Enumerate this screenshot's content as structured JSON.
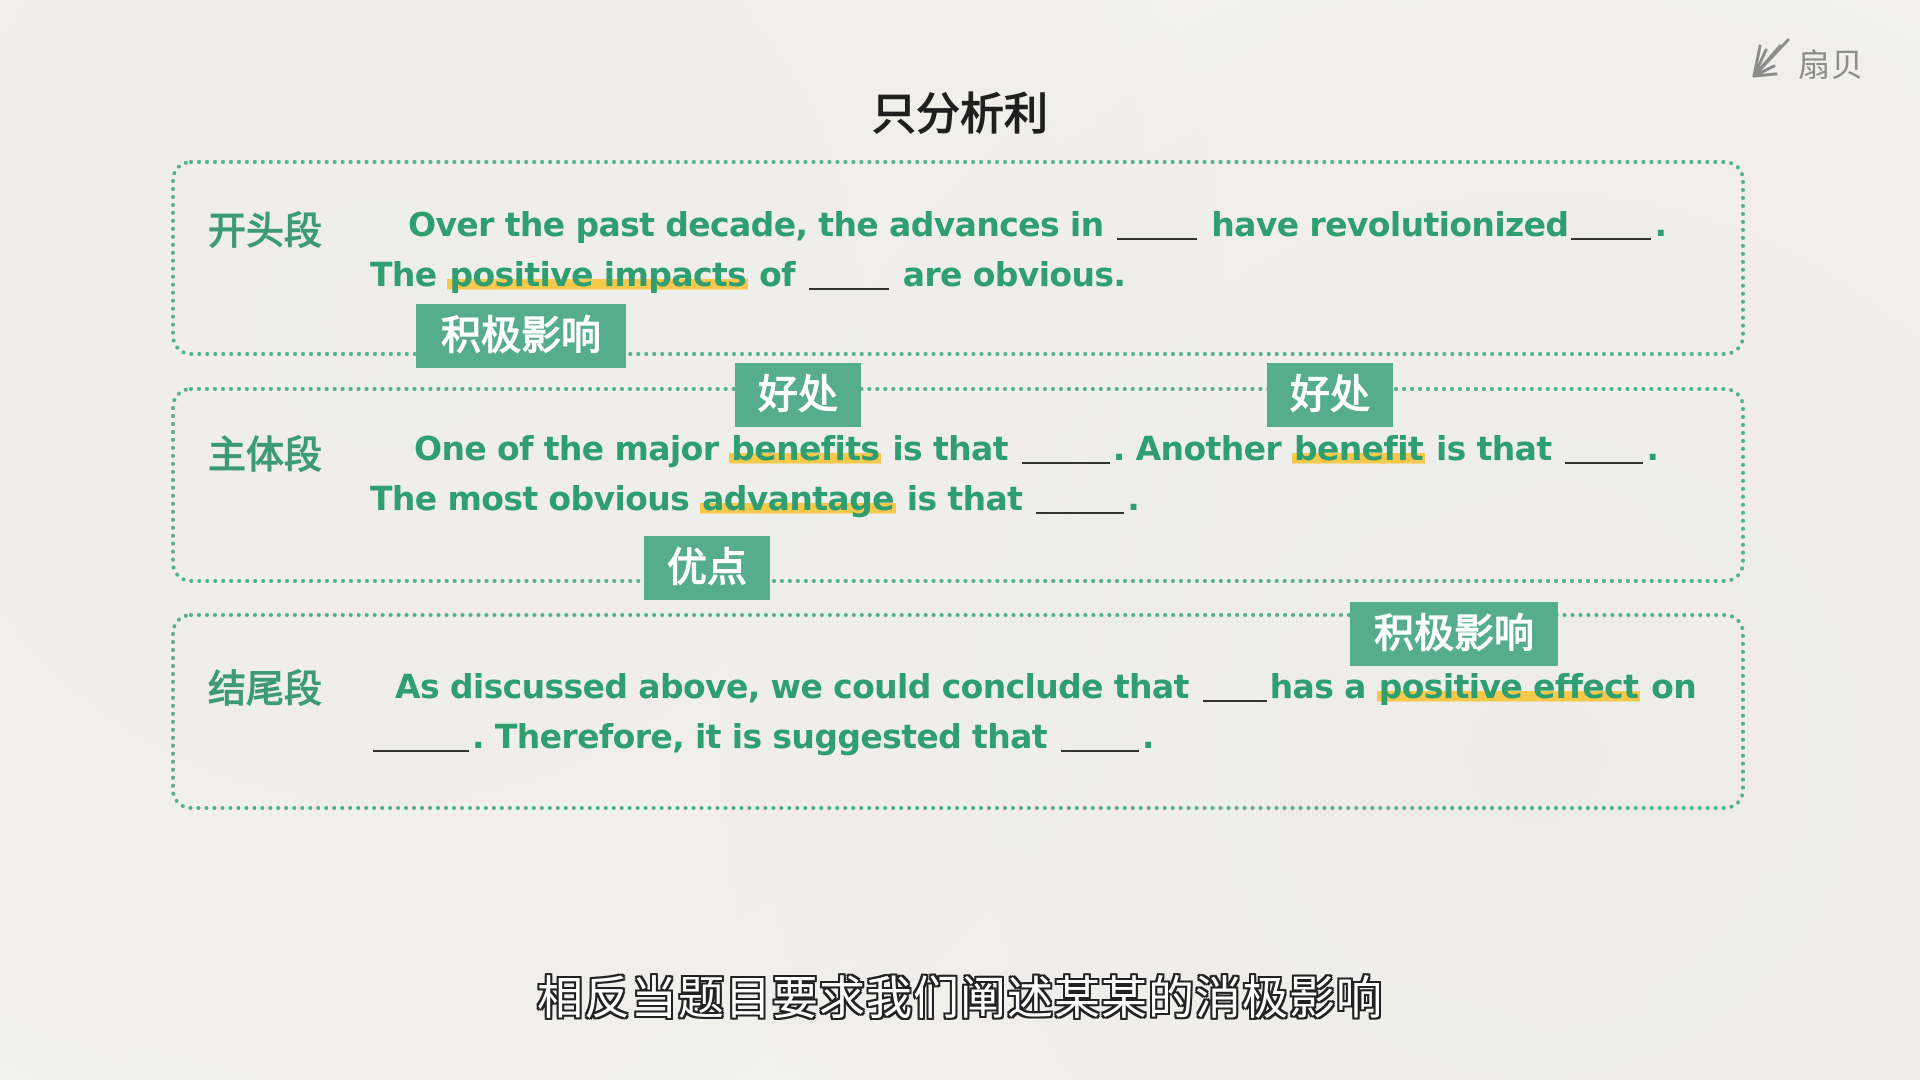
{
  "brand": {
    "name": "扇贝",
    "icon": "shanbay-logo-icon"
  },
  "title": "只分析利",
  "sections": {
    "opening": {
      "label": "开头段",
      "t1": "Over the past decade, the advances in",
      "t2": "have revolutionized",
      "t3": ". The",
      "hl1": "positive impacts",
      "t4": "of",
      "t5": "are obvious.",
      "tag": "积极影响"
    },
    "body": {
      "label": "主体段",
      "t1": "One of the major",
      "hl1": "benefits",
      "t2": "is that",
      "t3": ". Another",
      "hl2": "benefit",
      "t4": "is that",
      "t5": ". The most obvious",
      "hl3": "advantage",
      "t6": "is that",
      "t7": ".",
      "tag1": "好处",
      "tag2": "好处",
      "tag3": "优点"
    },
    "closing": {
      "label": "结尾段",
      "t1": "As discussed above, we could conclude that",
      "t2": "has a",
      "hl1": "positive effect",
      "t3": "on",
      "t4": ". Therefore, it is suggested that",
      "t5": ".",
      "tag": "积极影响"
    }
  },
  "subtitle": "相反当题目要求我们阐述某某的消极影响",
  "colors": {
    "accent_green": "#2f9e70",
    "tag_green": "#55ad8d",
    "highlight_yellow": "#f6c94a",
    "background": "#f1f0ed"
  }
}
